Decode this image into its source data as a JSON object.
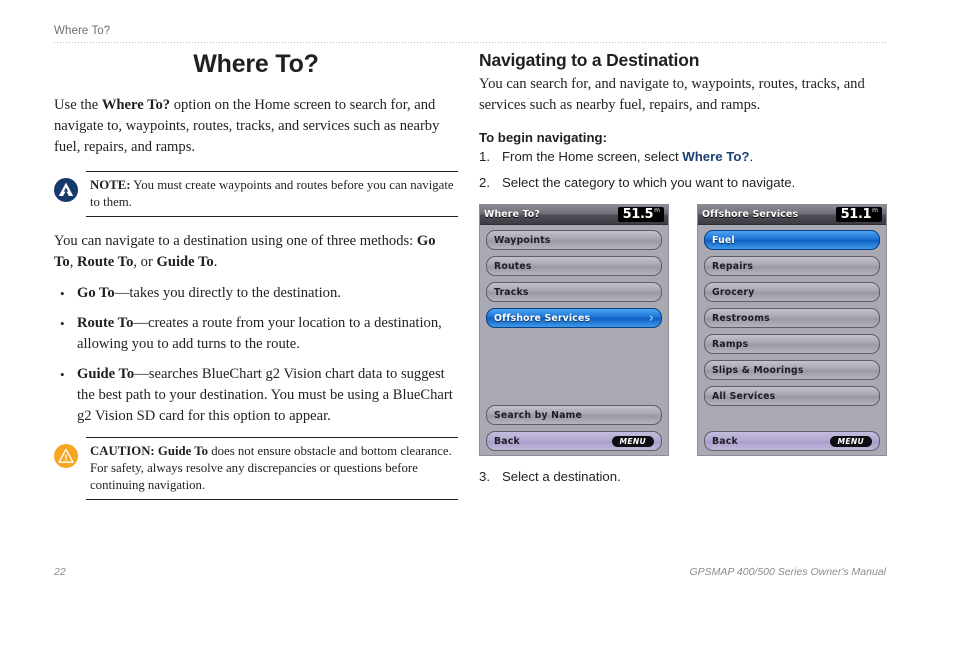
{
  "running_header": {
    "text": "Where To?"
  },
  "left_column": {
    "chapter_title": "Where To?",
    "intro_paragraph_parts": [
      {
        "text": "Use the ",
        "bold": false
      },
      {
        "text": "Where To?",
        "bold": true
      },
      {
        "text": " option on the Home screen to search for, and navigate to, waypoints, routes, tracks, and services such as nearby fuel, repairs, and ramps.",
        "bold": false
      }
    ],
    "note_callout": {
      "icon": "garmin-note-icon",
      "icon_color": "#173a6d",
      "label": "NOTE:",
      "text": " You must create waypoints and routes before you can navigate to them."
    },
    "methods_paragraph_parts": [
      {
        "text": "You can navigate to a destination using one of three methods: ",
        "bold": false
      },
      {
        "text": "Go To",
        "bold": true
      },
      {
        "text": ", ",
        "bold": false
      },
      {
        "text": "Route To",
        "bold": true
      },
      {
        "text": ", or ",
        "bold": false
      },
      {
        "text": "Guide To",
        "bold": true
      },
      {
        "text": ".",
        "bold": false
      }
    ],
    "bullets": [
      [
        {
          "text": "Go To",
          "bold": true
        },
        {
          "text": "—takes you directly to the destination.",
          "bold": false
        }
      ],
      [
        {
          "text": "Route To",
          "bold": true
        },
        {
          "text": "—creates a route from your location to a destination, allowing you to add turns to the route.",
          "bold": false
        }
      ],
      [
        {
          "text": "Guide To",
          "bold": true
        },
        {
          "text": "—searches BlueChart g2 Vision chart data to suggest the best path to your destination. You must be using a BlueChart g2 Vision SD card for this option to appear.",
          "bold": false
        }
      ]
    ],
    "caution_callout": {
      "icon": "warning-triangle-icon",
      "icon_color": "#f5a623",
      "label": "CAUTION: Guide To",
      "text": " does not ensure obstacle and bottom clearance. For safety, always resolve any discrepancies or questions before continuing navigation."
    }
  },
  "right_column": {
    "section_title": "Navigating to a Destination",
    "intro_paragraph": "You can search for, and navigate to, waypoints, routes, tracks, and services such as nearby fuel, repairs, and ramps.",
    "steps_heading": "To begin navigating:",
    "steps": [
      {
        "num": "1.",
        "parts": [
          {
            "text": "From the Home screen, select ",
            "link": false
          },
          {
            "text": "Where To?",
            "link": true
          },
          {
            "text": ".",
            "link": false
          }
        ]
      },
      {
        "num": "2.",
        "parts": [
          {
            "text": "Select the category to which you want to navigate.",
            "link": false
          }
        ]
      }
    ],
    "final_step": {
      "num": "3.",
      "text": "Select a destination."
    }
  },
  "devices": {
    "accent_selected": "#1f76d8",
    "footer_bar_color": "#b3a9d2",
    "left": {
      "name": "where-to-screen",
      "title": "Where To?",
      "depth_value": "51.5",
      "depth_unit": "m",
      "items": [
        {
          "label": "Waypoints",
          "selected": false
        },
        {
          "label": "Routes",
          "selected": false
        },
        {
          "label": "Tracks",
          "selected": false
        },
        {
          "label": "Offshore Services",
          "selected": true,
          "chevron": "›"
        }
      ],
      "search_button": "Search by Name",
      "back_button": "Back",
      "menu_pill": "MENU"
    },
    "right": {
      "name": "offshore-services-screen",
      "title": "Offshore Services",
      "depth_value": "51.1",
      "depth_unit": "m",
      "items": [
        {
          "label": "Fuel",
          "selected": true
        },
        {
          "label": "Repairs",
          "selected": false
        },
        {
          "label": "Grocery",
          "selected": false
        },
        {
          "label": "Restrooms",
          "selected": false
        },
        {
          "label": "Ramps",
          "selected": false
        },
        {
          "label": "Slips & Moorings",
          "selected": false
        },
        {
          "label": "All Services",
          "selected": false
        }
      ],
      "back_button": "Back",
      "menu_pill": "MENU"
    }
  },
  "footer": {
    "page_number": "22",
    "manual_title": "GPSMAP 400/500 Series Owner's Manual"
  }
}
